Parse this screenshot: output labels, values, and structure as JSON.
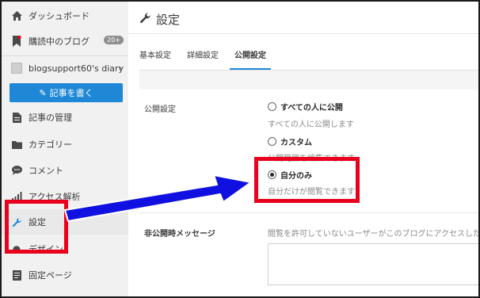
{
  "sidebar": {
    "dashboard": "ダッシュボード",
    "subscribed": "購読中のブログ",
    "subscribed_badge": "20+",
    "blog_name": "blogsupport60's diary",
    "write_button": "記事を書く",
    "items": [
      "記事の管理",
      "カテゴリー",
      "コメント",
      "アクセス解析",
      "設定",
      "デザイン",
      "固定ページ"
    ]
  },
  "main": {
    "title": "設定",
    "tabs": [
      "基本設定",
      "詳細設定",
      "公開設定"
    ],
    "visibility": {
      "label": "公開設定",
      "options": [
        {
          "label": "すべての人に公開",
          "desc": "すべての人に公開します",
          "checked": false
        },
        {
          "label": "カスタム",
          "desc": "公開範囲を編集できます",
          "checked": false
        },
        {
          "label": "自分のみ",
          "desc": "自分だけが閲覧できます",
          "checked": true
        }
      ]
    },
    "private_message": {
      "label": "非公開時メッセージ",
      "desc": "閲覧を許可していないユーザーがこのブログにアクセスしたとき、"
    }
  },
  "colors": {
    "accent": "#1f88d6",
    "highlight": "#e8001c",
    "arrow": "#1010e0"
  }
}
